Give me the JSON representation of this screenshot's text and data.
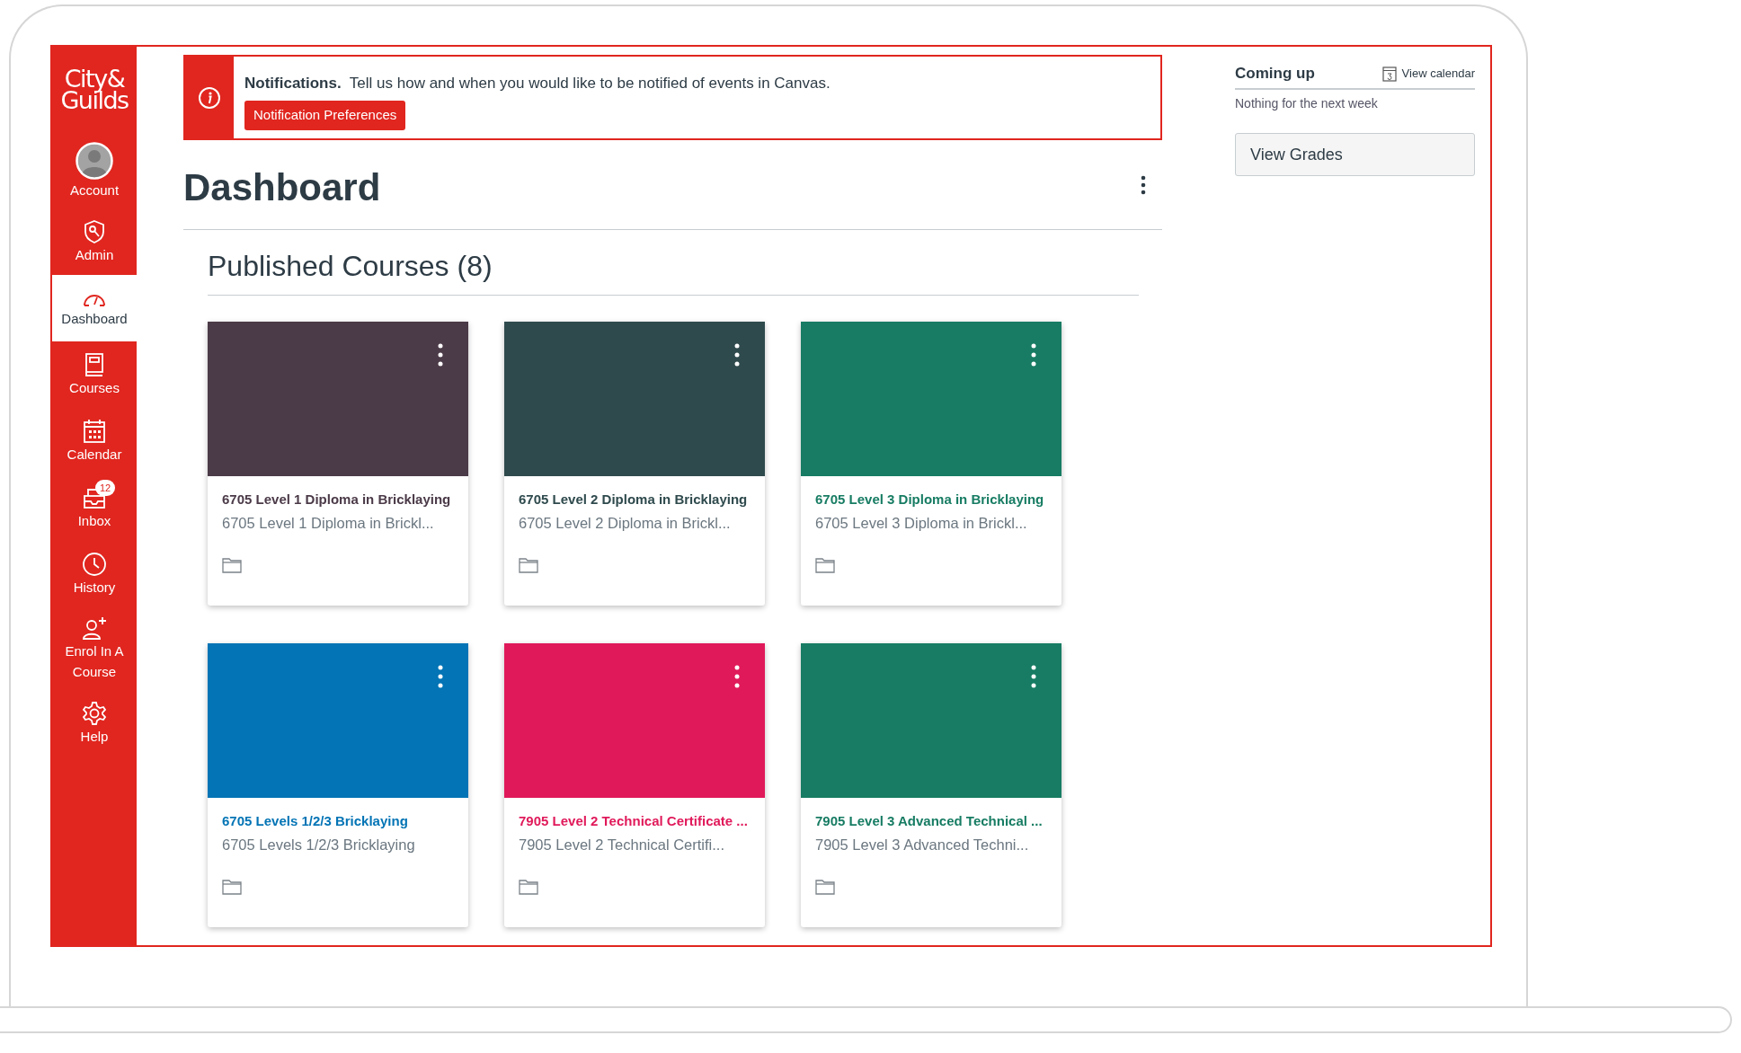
{
  "sidebar": {
    "logo": [
      "City&",
      "Guilds"
    ],
    "items": [
      {
        "label": "Account",
        "selected": false
      },
      {
        "label": "Admin",
        "selected": false
      },
      {
        "label": "Dashboard",
        "selected": true
      },
      {
        "label": "Courses",
        "selected": false
      },
      {
        "label": "Calendar",
        "selected": false
      },
      {
        "label": "Inbox",
        "selected": false,
        "badge": "12"
      },
      {
        "label": "History",
        "selected": false
      },
      {
        "label": "Enrol In A Course",
        "selected": false
      },
      {
        "label": "Help",
        "selected": false
      }
    ]
  },
  "notification": {
    "title": "Notifications.",
    "message": "Tell us how and when you would like to be notified of events in Canvas.",
    "button": "Notification Preferences"
  },
  "page_title": "Dashboard",
  "section_title": "Published Courses (8)",
  "courses": [
    {
      "title": "6705 Level 1 Diploma in Bricklaying",
      "subtitle": "6705 Level 1 Diploma in Brickl...",
      "color": "#4b3a48"
    },
    {
      "title": "6705 Level 2 Diploma in Bricklaying",
      "subtitle": "6705 Level 2 Diploma in Brickl...",
      "color": "#2f4a4d"
    },
    {
      "title": "6705 Level 3 Diploma in Bricklaying",
      "subtitle": "6705 Level 3 Diploma in Brickl...",
      "color": "#177c63"
    },
    {
      "title": "6705 Levels 1/2/3 Bricklaying",
      "subtitle": "6705 Levels 1/2/3 Bricklaying",
      "color": "#0374b5"
    },
    {
      "title": "7905 Level 2 Technical Certificate ...",
      "subtitle": "7905 Level 2 Technical Certifi...",
      "color": "#e0195a"
    },
    {
      "title": "7905 Level 3 Advanced Technical ...",
      "subtitle": "7905 Level 3 Advanced Techni...",
      "color": "#177c63"
    }
  ],
  "coming_up": {
    "title": "Coming up",
    "link": "View calendar",
    "empty": "Nothing for the next week"
  },
  "grades_button": "View Grades"
}
